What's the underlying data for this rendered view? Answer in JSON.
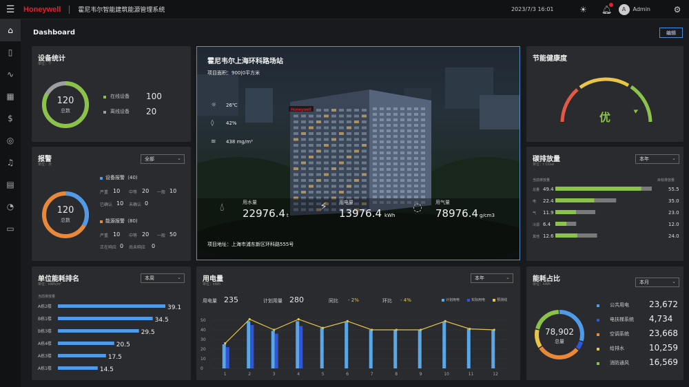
{
  "topbar": {
    "brand": "Honeywell",
    "title": "霍尼韦尔智能建筑能源管理系统",
    "datetime": "2023/7/3  16:01",
    "user_initial": "A",
    "user_name": "Admin"
  },
  "page": {
    "title": "Dashboard",
    "edit_label": "编辑"
  },
  "device_stats": {
    "title": "设备统计",
    "unit": "单位：个",
    "total": "120",
    "total_label": "总数",
    "online_label": "在线设备",
    "online": "100",
    "offline_label": "离线设备",
    "offline": "20",
    "online_color": "#8bc34a",
    "offline_color": "#9e9e9e"
  },
  "alarm": {
    "title": "报警",
    "unit": "单位：次",
    "filter": "全部",
    "total": "120",
    "total_label": "总数",
    "device_alarm_label": "设备报警（40)",
    "device": {
      "serious_label": "严重",
      "serious": "10",
      "medium_label": "中等",
      "medium": "20",
      "normal_label": "一般",
      "normal": "10",
      "confirmed_label": "已确认",
      "confirmed": "10",
      "unconfirmed_label": "未确认",
      "unconfirmed": "0"
    },
    "energy_alarm_label": "能源报警（80)",
    "energy": {
      "serious_label": "严重",
      "serious": "10",
      "medium_label": "中等",
      "medium": "20",
      "normal_label": "一般",
      "normal": "50",
      "responding_label": "正在响应",
      "responding": "0",
      "unresponded_label": "尚未响应",
      "unresponded": "0"
    },
    "device_color": "#4f9be8",
    "energy_color": "#e8883a"
  },
  "project": {
    "name": "霍尼韦尔上海环科路场站",
    "area": "项目面积：900|0平方米",
    "temp": "26℃",
    "humidity": "42%",
    "pm": "438 mg/m³",
    "water_label": "用水量",
    "water": "22976.4",
    "water_unit": "t",
    "elec_label": "用电量",
    "elec": "13976.4",
    "elec_unit": "kWh",
    "gas_label": "用气量",
    "gas": "78976.4",
    "gas_unit": "g/cm3",
    "address": "项目地址：上海市浦东新区环科路555号",
    "sign": "Honeywell"
  },
  "health": {
    "title": "节能健康度",
    "grade": "优",
    "grade_color": "#8bc34a",
    "level": 0.85
  },
  "carbon": {
    "title": "碳排放量",
    "unit": "单位：t CO₂e",
    "filter": "本年",
    "left_label": "当前排放量",
    "right_label": "目标排放量",
    "rows": [
      {
        "cat": "总量",
        "current": 49.4,
        "target": 55.5
      },
      {
        "cat": "电",
        "current": 22.4,
        "target": 35.0
      },
      {
        "cat": "气",
        "current": 11.9,
        "target": 23.0
      },
      {
        "cat": "冷源",
        "current": 6.4,
        "target": 12.0
      },
      {
        "cat": "其他",
        "current": 12.6,
        "target": 24.0
      }
    ],
    "current_color": "#8bc34a",
    "target_color": "#7a7a7a"
  },
  "ranking": {
    "title": "单位能耗排名",
    "unit": "单位：kWh/m²",
    "sublabel": "当前排放量",
    "filter": "本周",
    "rows": [
      {
        "name": "A栋2楼",
        "value": "39.1"
      },
      {
        "name": "B栋1楼",
        "value": "34.5"
      },
      {
        "name": "B栋3楼",
        "value": "29.5"
      },
      {
        "name": "A栋4楼",
        "value": "20.5"
      },
      {
        "name": "A栋3楼",
        "value": "17.5"
      },
      {
        "name": "A栋1楼",
        "value": "14.5"
      }
    ],
    "bar_color": "#4f9be8"
  },
  "power": {
    "title": "用电量",
    "unit": "单位：kWh",
    "filter": "本年",
    "usage_label": "用电量",
    "usage": "235",
    "plan_label": "计划用量",
    "plan": "280",
    "yoy_label": "同比",
    "yoy": "- 2%",
    "mom_label": "环比",
    "mom": "- 4%",
    "delta_color": "#e8c547",
    "legend": [
      "计划用电",
      "实际用电",
      "预测线"
    ],
    "colors": {
      "plan": "#5aa7e8",
      "actual": "#2f56d6",
      "forecast": "#e8c547"
    }
  },
  "chart_data": {
    "type": "bar",
    "categories": [
      "1",
      "2",
      "3",
      "4",
      "5",
      "6",
      "7",
      "8",
      "9",
      "10",
      "11",
      "12"
    ],
    "series": [
      {
        "name": "计划用电",
        "values": [
          25,
          49,
          39,
          49,
          42,
          48,
          40,
          40,
          40,
          48,
          41,
          40
        ]
      },
      {
        "name": "实际用电",
        "values": [
          22,
          45,
          36,
          44,
          null,
          null,
          null,
          null,
          null,
          null,
          null,
          null
        ]
      },
      {
        "name": "预测线",
        "values": [
          26,
          51,
          40,
          51,
          42,
          49,
          40,
          40,
          40,
          49,
          41,
          40
        ]
      }
    ],
    "ylim": [
      0,
      50
    ],
    "yticks": [
      "0",
      "10",
      "20",
      "30",
      "40",
      "50"
    ]
  },
  "share": {
    "title": "能耗占比",
    "unit": "单位：kWh",
    "filter": "本月",
    "total": "78,902",
    "total_label": "总量",
    "items": [
      {
        "label": "公共用电",
        "value": "23,672",
        "color": "#4f9be8"
      },
      {
        "label": "电扶梯系统",
        "value": "4,734",
        "color": "#2f56d6"
      },
      {
        "label": "空调系统",
        "value": "23,668",
        "color": "#e8883a"
      },
      {
        "label": "给排水",
        "value": "10,259",
        "color": "#e8c547"
      },
      {
        "label": "消防通风",
        "value": "16,569",
        "color": "#8bc34a"
      }
    ],
    "shares": [
      23672,
      4734,
      23668,
      10259,
      16569
    ]
  }
}
